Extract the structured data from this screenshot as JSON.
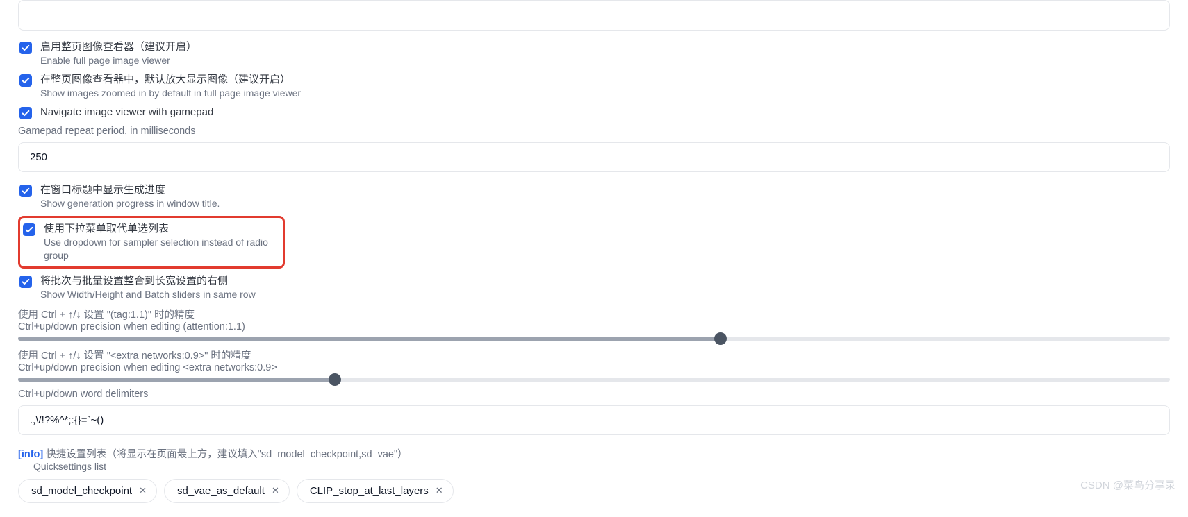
{
  "checkboxes": {
    "fullpage": {
      "cn": "启用整页图像查看器（建议开启）",
      "en": "Enable full page image viewer"
    },
    "zoomed": {
      "cn": "在整页图像查看器中，默认放大显示图像（建议开启）",
      "en": "Show images zoomed in by default in full page image viewer"
    },
    "gamepad": {
      "label": "Navigate image viewer with gamepad"
    },
    "progress": {
      "cn": "在窗口标题中显示生成进度",
      "en": "Show generation progress in window title."
    },
    "dropdown": {
      "cn": "使用下拉菜单取代单选列表",
      "en": "Use dropdown for sampler selection instead of radio group"
    },
    "batch": {
      "cn": "将批次与批量设置整合到长宽设置的右侧",
      "en": "Show Width/Height and Batch sliders in same row"
    }
  },
  "gamepad_period": {
    "label": "Gamepad repeat period, in milliseconds",
    "value": "250"
  },
  "slider1": {
    "cn": "使用 Ctrl + ↑/↓ 设置 \"(tag:1.1)\" 时的精度",
    "en": "Ctrl+up/down precision when editing (attention:1.1)",
    "pct": 61.0
  },
  "slider2": {
    "cn": "使用 Ctrl + ↑/↓ 设置 \"<extra networks:0.9>\" 时的精度",
    "en": "Ctrl+up/down precision when editing <extra networks:0.9>",
    "pct": 27.5
  },
  "delimiters": {
    "label": "Ctrl+up/down word delimiters",
    "value": ".,\\/!?%^*;:{}=`~()"
  },
  "quicksettings": {
    "info_tag": "[info]",
    "cn": "快捷设置列表（将显示在页面最上方，建议填入\"sd_model_checkpoint,sd_vae\"）",
    "sub": "Quicksettings list",
    "tags": [
      "sd_model_checkpoint",
      "sd_vae_as_default",
      "CLIP_stop_at_last_layers"
    ]
  },
  "watermark": "CSDN @菜鸟分享录"
}
